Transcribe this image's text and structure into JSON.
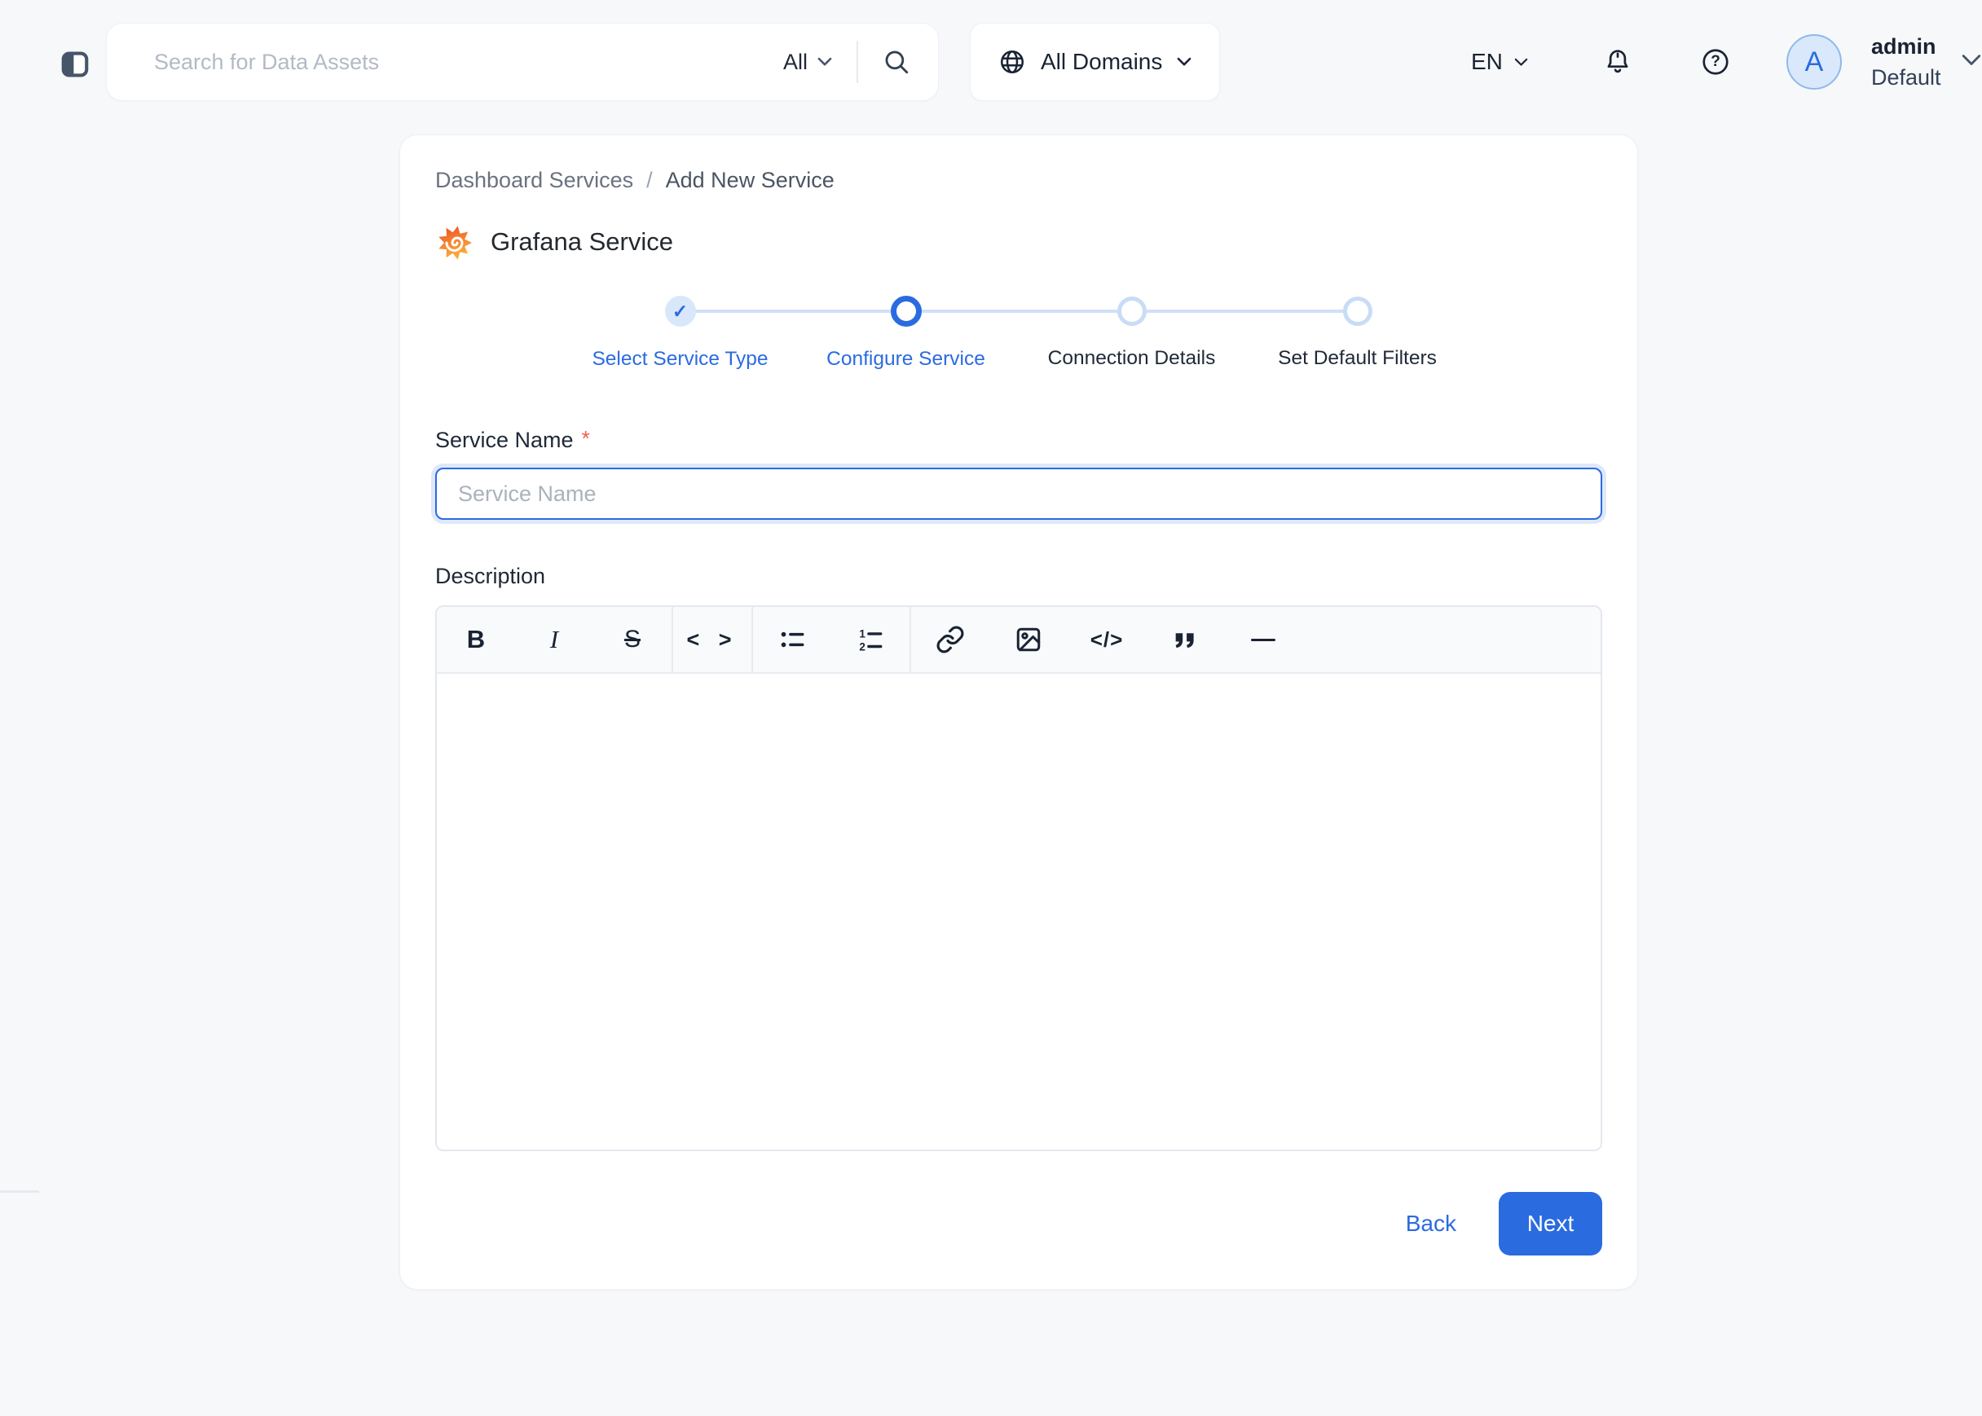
{
  "topbar": {
    "search_placeholder": "Search for Data Assets",
    "search_scope": "All",
    "domains": "All Domains",
    "language": "EN",
    "help_glyph": "?",
    "user_initial": "A",
    "user_name": "admin",
    "user_team": "Default"
  },
  "breadcrumb": {
    "parent": "Dashboard Services",
    "separator": "/",
    "current": "Add New Service"
  },
  "page": {
    "title": "Grafana Service"
  },
  "stepper": {
    "check_glyph": "✓",
    "steps": [
      {
        "label": "Select Service Type",
        "state": "completed"
      },
      {
        "label": "Configure Service",
        "state": "active"
      },
      {
        "label": "Connection Details",
        "state": "pending"
      },
      {
        "label": "Set Default Filters",
        "state": "pending"
      }
    ]
  },
  "form": {
    "service_name_label": "Service Name",
    "required_marker": "*",
    "service_name_placeholder": "Service Name",
    "service_name_value": "",
    "description_label": "Description",
    "description_value": ""
  },
  "editor": {
    "toolbar": {
      "bold": "B",
      "italic": "I",
      "strikethrough": "S",
      "inline_code": "< >",
      "code_block": "</>"
    }
  },
  "actions": {
    "back": "Back",
    "next": "Next"
  },
  "colors": {
    "primary": "#2b6be0",
    "stepper_connector": "#cfe0f7",
    "step_completed_bg": "#d9e7fb",
    "required_marker": "#f25c4a",
    "page_bg": "#f7f8fa"
  }
}
